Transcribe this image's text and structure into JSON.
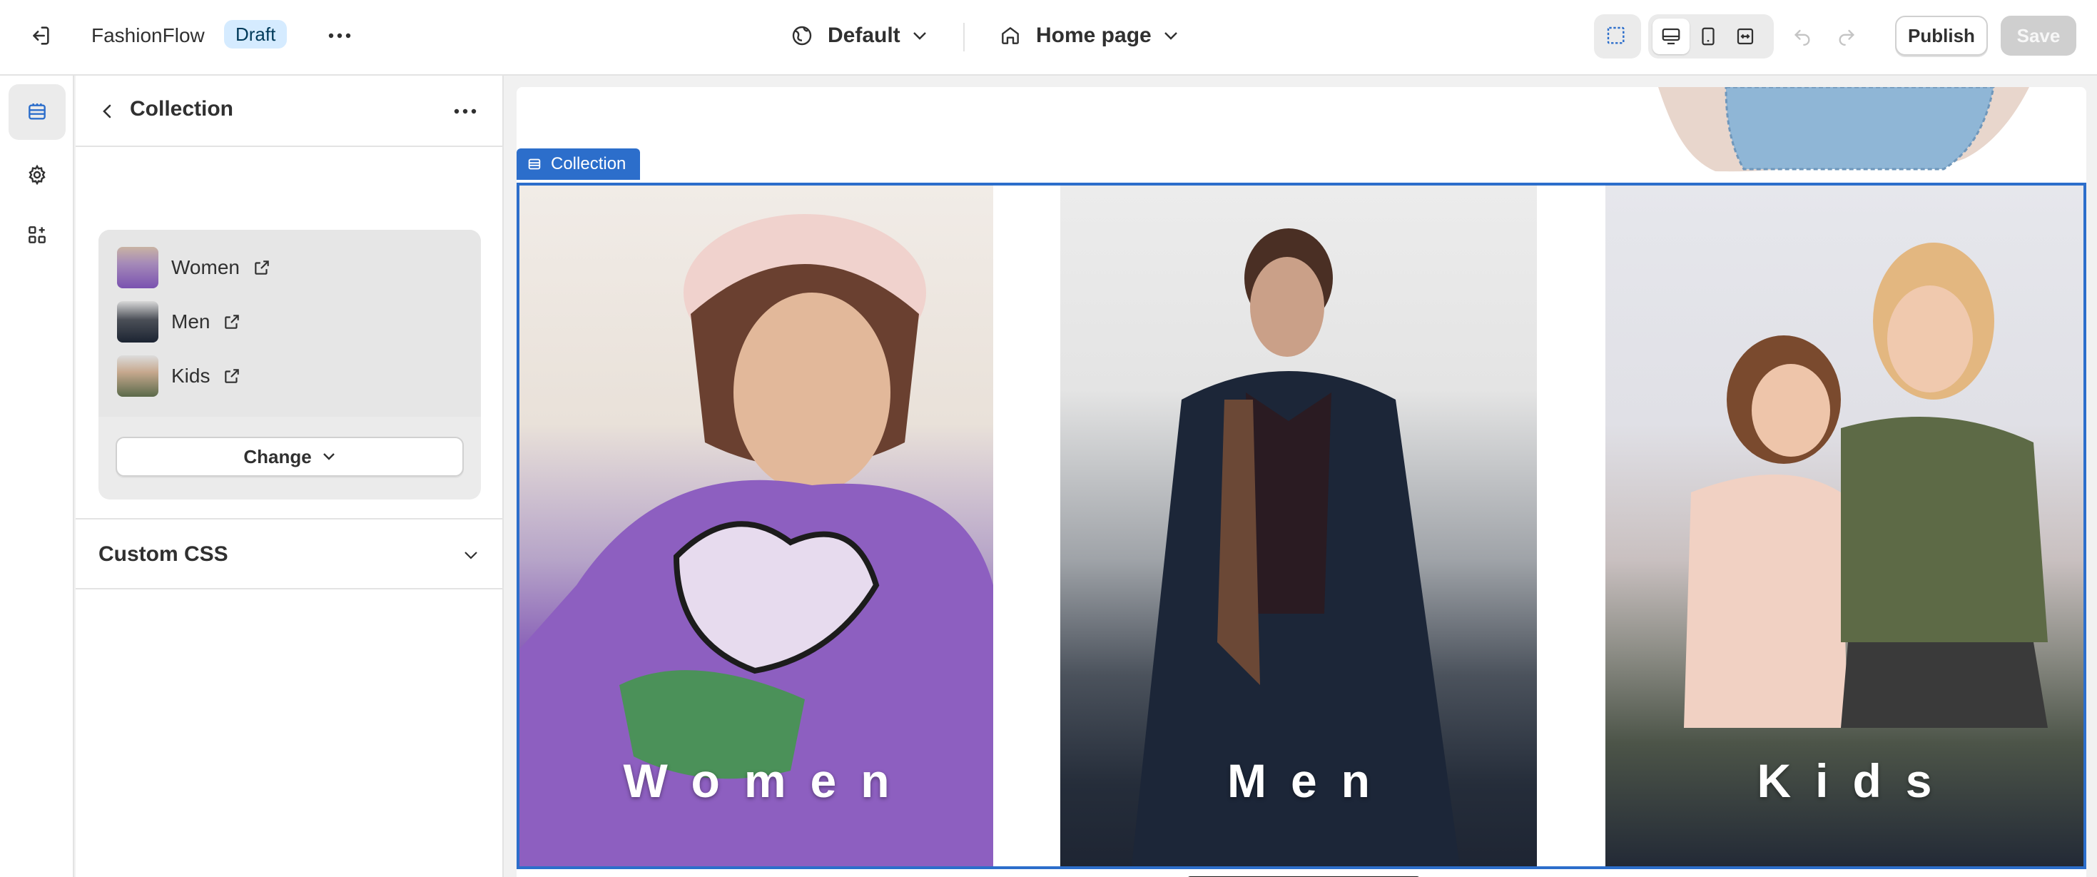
{
  "topbar": {
    "app_name": "FashionFlow",
    "status_badge": "Draft",
    "theme_selector": "Default",
    "page_selector": "Home page",
    "publish_label": "Publish",
    "save_label": "Save"
  },
  "rail": {
    "items": [
      {
        "icon": "sections-icon",
        "active": true
      },
      {
        "icon": "settings-gear-icon",
        "active": false
      },
      {
        "icon": "apps-icon",
        "active": false
      }
    ]
  },
  "panel": {
    "title": "Collection",
    "collections": [
      {
        "name": "Women",
        "thumb": "women"
      },
      {
        "name": "Men",
        "thumb": "men"
      },
      {
        "name": "Kids",
        "thumb": "kids"
      }
    ],
    "change_label": "Change",
    "custom_css_label": "Custom CSS"
  },
  "preview": {
    "selection_tag": "Collection",
    "cards": [
      "Women",
      "Men",
      "Kids"
    ]
  },
  "colors": {
    "accent": "#2c6ecb",
    "draft_badge_bg": "#d5ebff",
    "save_disabled": "#cfcfcf"
  }
}
